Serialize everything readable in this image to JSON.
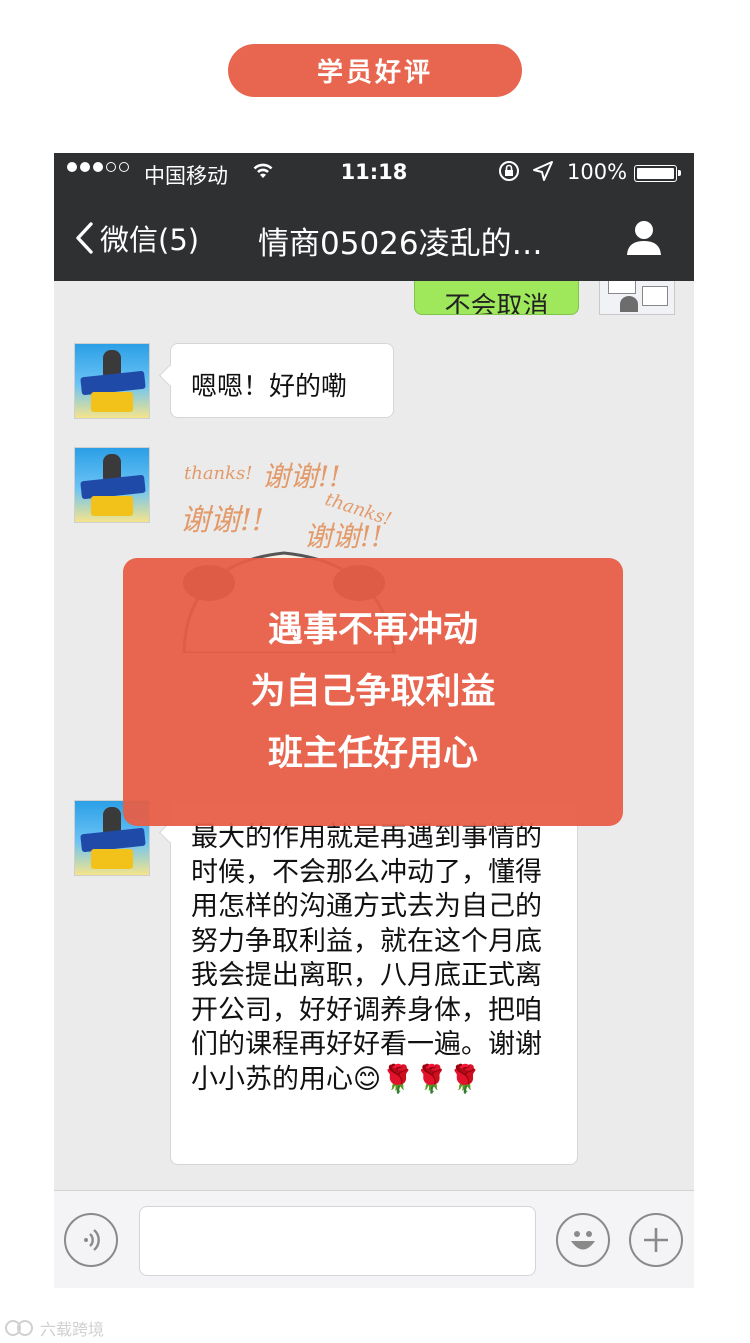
{
  "banner": {
    "label": "学员好评"
  },
  "status_bar": {
    "carrier": "中国移动",
    "time": "11:18",
    "battery": "100%"
  },
  "nav": {
    "back_label": "微信(5)",
    "title": "情商05026凌乱的…"
  },
  "messages": {
    "partial_outgoing": "不会取消",
    "incoming_1": "嗯嗯！好的嘞",
    "sticker_words": [
      "thanks!",
      "谢谢!!",
      "谢谢!!",
      "thanks!",
      "谢谢!!"
    ],
    "incoming_long": "最大的作用就是再遇到事情的时候，不会那么冲动了，懂得用怎样的沟通方式去为自己的努力争取利益，就在这个月底我会提出离职，八月底正式离开公司，好好调养身体，把咱们的课程再好好看一遍。谢谢小小苏的用心",
    "incoming_long_emoji": "😊🌹🌹🌹"
  },
  "overlay": {
    "lines": [
      "遇事不再冲动",
      "为自己争取利益",
      "班主任好用心"
    ]
  },
  "watermark": {
    "text": "六载跨境"
  },
  "colors": {
    "accent": "#e8664f",
    "nav_bg": "#2e3032",
    "chat_bg": "#ebebeb",
    "outgoing_bubble": "#9fe85b"
  },
  "icons": [
    "wifi-icon",
    "rotation-lock-icon",
    "location-icon",
    "battery-icon",
    "back-chevron-icon",
    "contact-profile-icon",
    "voice-icon",
    "emoji-icon",
    "plus-icon"
  ]
}
